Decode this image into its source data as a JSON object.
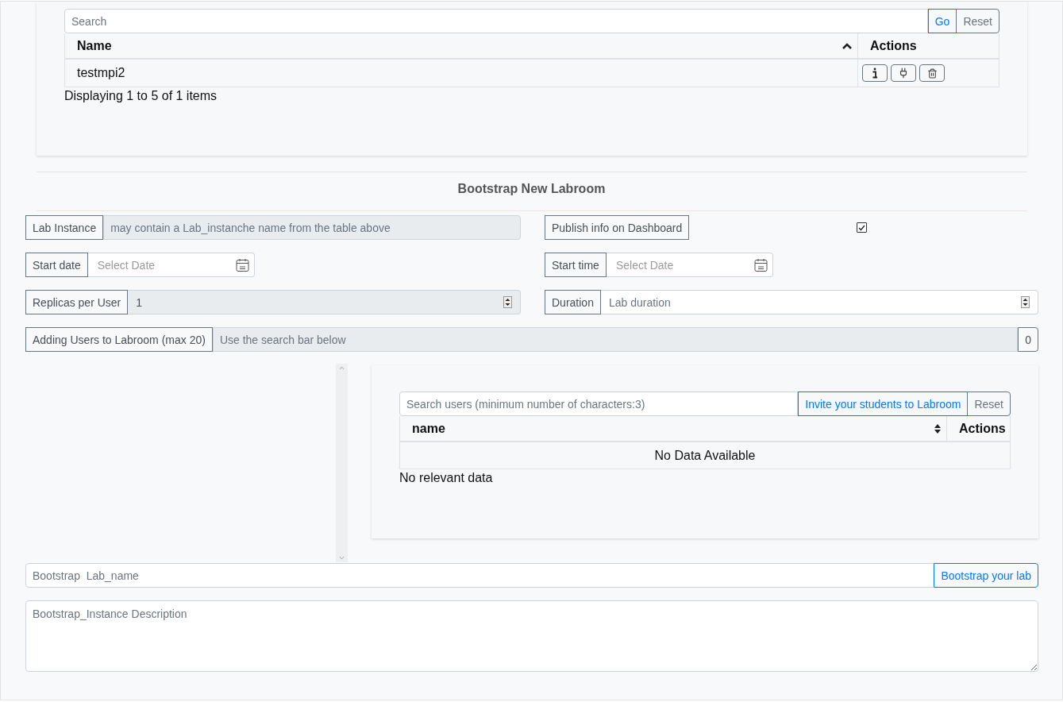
{
  "instances": {
    "search": {
      "placeholder": "Search"
    },
    "go_button": "Go",
    "reset_button": "Reset",
    "columns": [
      {
        "label": "Name",
        "sortable": true,
        "sorted": true
      },
      {
        "label": "Actions",
        "sortable": false
      }
    ],
    "rows": [
      {
        "name": "testmpi2",
        "actions": [
          {
            "kind": "info"
          },
          {
            "kind": "plug"
          },
          {
            "kind": "trash"
          }
        ]
      }
    ],
    "footer": "Displaying 1 to 5 of 1 items"
  },
  "section_title": "Bootstrap New Labroom",
  "form": {
    "lab_instance": {
      "label": "Lab Instance",
      "placeholder": "may contain a Lab_instanche name from the table above",
      "disabled": true
    },
    "publish": {
      "label": "Publish info on Dashboard",
      "checked": true
    },
    "start_date": {
      "label": "Start date",
      "placeholder": "Select Date"
    },
    "start_time": {
      "label": "Start time",
      "placeholder": "Select Date"
    },
    "replicas": {
      "label": "Replicas per User",
      "value": "1",
      "disabled": true
    },
    "duration": {
      "label": "Duration",
      "placeholder": "Lab duration",
      "disabled": false
    },
    "users": {
      "label": "Adding Users to Labroom (max 20)",
      "placeholder": "Use the search bar below",
      "count": "0",
      "disabled": true
    }
  },
  "users_panel": {
    "search": {
      "placeholder": "Search users (minimum number of characters:3)"
    },
    "invite_button": "Invite your students to Labroom",
    "reset_button": "Reset",
    "columns": [
      {
        "label": "name",
        "sortable": true,
        "sorted": false
      },
      {
        "label": "Actions",
        "sortable": false
      }
    ],
    "empty_text": "No Data Available",
    "footer": "No relevant data"
  },
  "bootstrap": {
    "name": {
      "placeholder": "Bootstrap  Lab_name"
    },
    "button": "Bootstrap your lab",
    "description": {
      "placeholder": "Bootstrap_Instance Description"
    }
  }
}
